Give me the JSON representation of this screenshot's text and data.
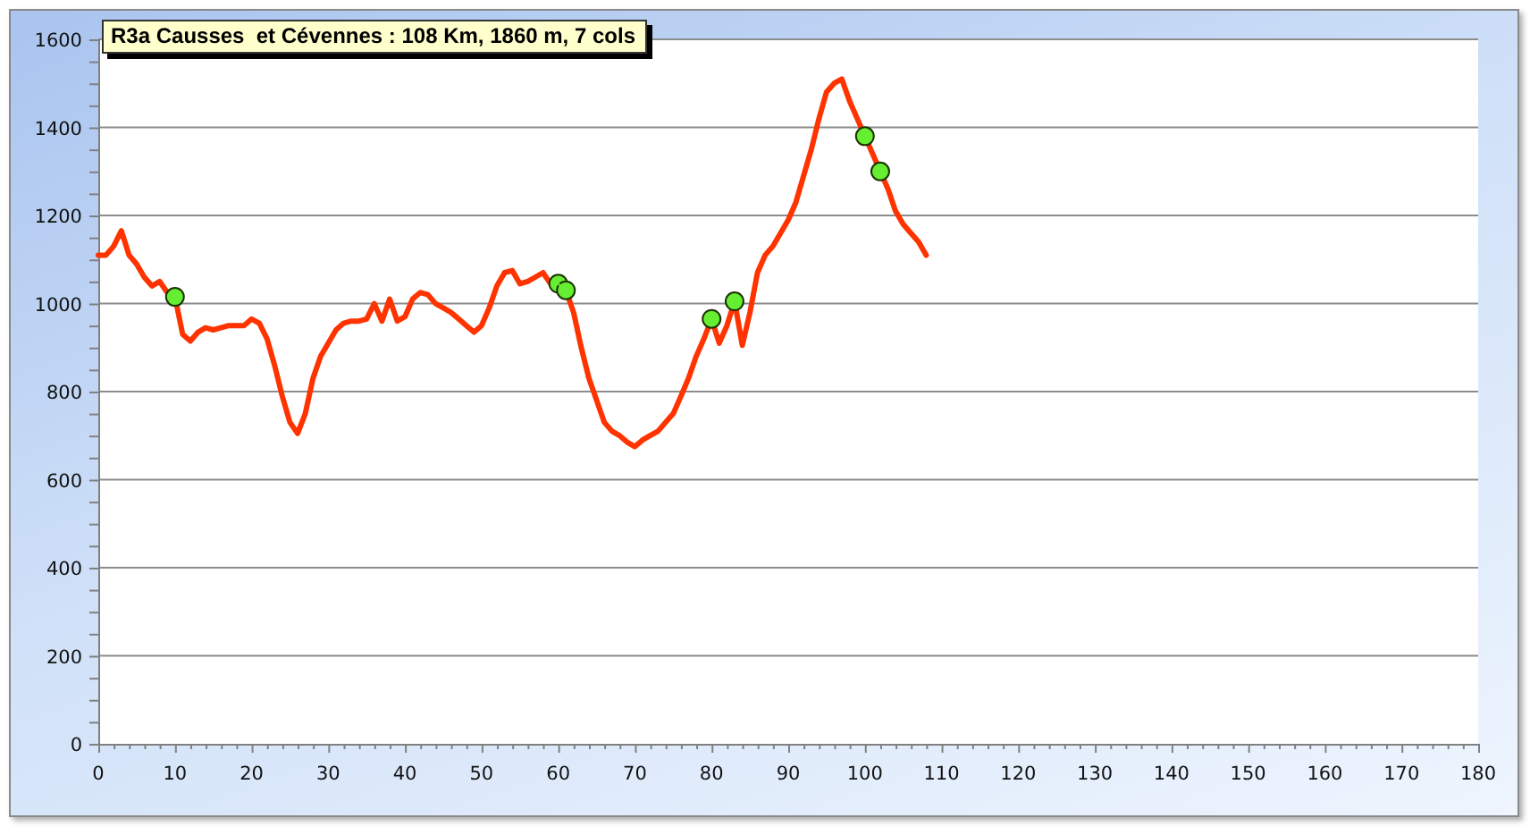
{
  "chart": {
    "chart_data": {
      "type": "line",
      "title": "R3a Causses  et Cévennes : 108 Km, 1860 m, 7 cols",
      "grid": true,
      "x": [
        0,
        1,
        2,
        3,
        4,
        5,
        6,
        7,
        8,
        9,
        10,
        11,
        12,
        13,
        14,
        15,
        16,
        17,
        18,
        19,
        20,
        21,
        22,
        23,
        24,
        25,
        26,
        27,
        28,
        29,
        30,
        31,
        32,
        33,
        34,
        35,
        36,
        37,
        38,
        39,
        40,
        41,
        42,
        43,
        44,
        45,
        46,
        47,
        48,
        49,
        50,
        51,
        52,
        53,
        54,
        55,
        56,
        57,
        58,
        59,
        60,
        61,
        62,
        63,
        64,
        65,
        66,
        67,
        68,
        69,
        70,
        71,
        72,
        73,
        74,
        75,
        76,
        77,
        78,
        79,
        80,
        81,
        82,
        83,
        84,
        85,
        86,
        87,
        88,
        89,
        90,
        91,
        92,
        93,
        94,
        95,
        96,
        97,
        98,
        99,
        100,
        101,
        102,
        103,
        104,
        105,
        106,
        107,
        108
      ],
      "series": [
        {
          "color": "#ff3300",
          "values": [
            1110,
            1110,
            1130,
            1165,
            1110,
            1090,
            1060,
            1040,
            1050,
            1025,
            1015,
            930,
            915,
            935,
            945,
            940,
            945,
            950,
            950,
            950,
            965,
            955,
            920,
            860,
            790,
            730,
            705,
            750,
            830,
            880,
            910,
            940,
            955,
            960,
            960,
            965,
            1000,
            960,
            1010,
            960,
            970,
            1010,
            1025,
            1020,
            1000,
            990,
            980,
            965,
            950,
            935,
            950,
            990,
            1040,
            1070,
            1075,
            1045,
            1050,
            1060,
            1070,
            1045,
            1045,
            1030,
            980,
            900,
            830,
            780,
            730,
            710,
            700,
            685,
            675,
            690,
            700,
            710,
            730,
            750,
            790,
            830,
            880,
            920,
            965,
            910,
            950,
            1005,
            905,
            980,
            1070,
            1110,
            1130,
            1160,
            1190,
            1230,
            1290,
            1350,
            1420,
            1480,
            1500,
            1510,
            1460,
            1420,
            1380,
            1340,
            1300,
            1260,
            1210,
            1180,
            1160,
            1140,
            1110
          ]
        },
        {
          "color": "#66ee33",
          "marker": "circle",
          "values": [
            null,
            null,
            null,
            null,
            null,
            null,
            null,
            null,
            null,
            null,
            1015,
            null,
            null,
            null,
            null,
            null,
            null,
            null,
            null,
            null,
            null,
            null,
            null,
            null,
            null,
            null,
            null,
            null,
            null,
            null,
            null,
            null,
            null,
            null,
            null,
            null,
            null,
            null,
            null,
            null,
            null,
            null,
            null,
            null,
            null,
            null,
            null,
            null,
            null,
            null,
            null,
            null,
            null,
            null,
            null,
            null,
            null,
            null,
            null,
            null,
            1045,
            1030,
            null,
            null,
            null,
            null,
            null,
            null,
            null,
            null,
            null,
            null,
            null,
            null,
            null,
            null,
            null,
            null,
            null,
            null,
            965,
            null,
            null,
            1005,
            null,
            null,
            null,
            null,
            null,
            null,
            null,
            null,
            null,
            null,
            null,
            null,
            null,
            null,
            null,
            null,
            1380,
            null,
            1300,
            null,
            null,
            null,
            null,
            null,
            null
          ]
        }
      ],
      "xlim": [
        0,
        180
      ],
      "ylim": [
        0,
        1600
      ],
      "xticks": [
        0,
        10,
        20,
        30,
        40,
        50,
        60,
        70,
        80,
        90,
        100,
        110,
        120,
        130,
        140,
        150,
        160,
        170,
        180
      ],
      "yticks": [
        0,
        200,
        400,
        600,
        800,
        1000,
        1200,
        1400,
        1600
      ]
    }
  }
}
